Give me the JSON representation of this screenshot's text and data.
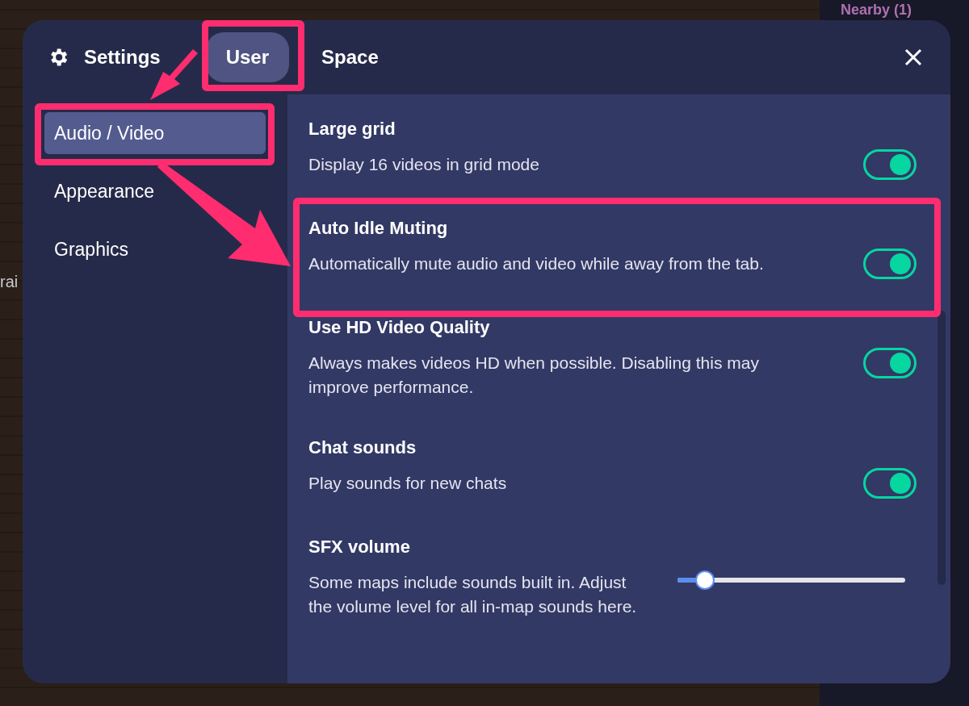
{
  "background_sidebar": {
    "heading": "Nearby (1)"
  },
  "map_label": "rai",
  "dialog": {
    "title": "Settings",
    "tabs": [
      {
        "label": "User",
        "selected": true
      },
      {
        "label": "Space",
        "selected": false
      }
    ],
    "nav": [
      {
        "label": "Audio / Video",
        "selected": true
      },
      {
        "label": "Appearance",
        "selected": false
      },
      {
        "label": "Graphics",
        "selected": false
      }
    ],
    "settings": [
      {
        "kind": "toggle",
        "title": "Large grid",
        "description": "Display 16 videos in grid mode",
        "on": true
      },
      {
        "kind": "toggle",
        "title": "Auto Idle Muting",
        "description": "Automatically mute audio and video while away from the tab.",
        "on": true
      },
      {
        "kind": "toggle",
        "title": "Use HD Video Quality",
        "description": "Always makes videos HD when possible. Disabling this may improve performance.",
        "on": true
      },
      {
        "kind": "toggle",
        "title": "Chat sounds",
        "description": "Play sounds for new chats",
        "on": true
      },
      {
        "kind": "slider",
        "title": "SFX volume",
        "description": "Some maps include sounds built in. Adjust the volume level for all in-map sounds here.",
        "level": 0.12
      }
    ]
  }
}
